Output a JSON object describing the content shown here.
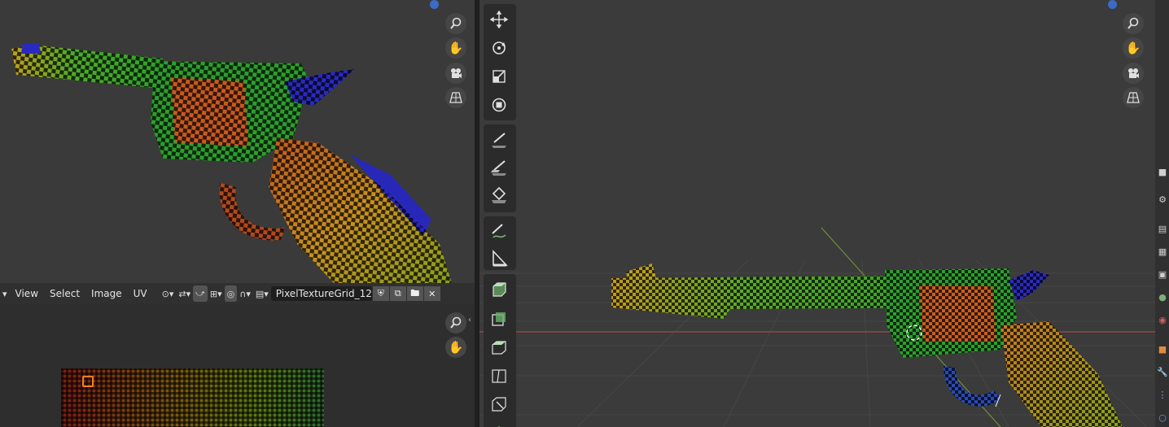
{
  "uv_editor": {
    "menus": [
      "View",
      "Select",
      "Image",
      "UV"
    ],
    "texture_name": "PixelTextureGrid_12.."
  },
  "left_viewport": {
    "nav_icons": [
      "zoom-icon",
      "hand-icon",
      "camera-icon",
      "grid-icon"
    ]
  },
  "right_viewport": {
    "nav_icons": [
      "zoom-icon",
      "hand-icon",
      "camera-icon",
      "grid-icon"
    ],
    "tools": [
      "move",
      "rotate",
      "scale",
      "transform",
      "annotate",
      "annotate-line",
      "annotate-polygon",
      "annotate-eraser",
      "measure",
      "add-cube",
      "extrude",
      "inset",
      "bevel",
      "loop-cut",
      "knife"
    ]
  },
  "colors": {
    "accent_blue": "#3b6bc6",
    "x_axis_red": "#a34a4a",
    "y_axis_green": "#7a9a3a"
  }
}
